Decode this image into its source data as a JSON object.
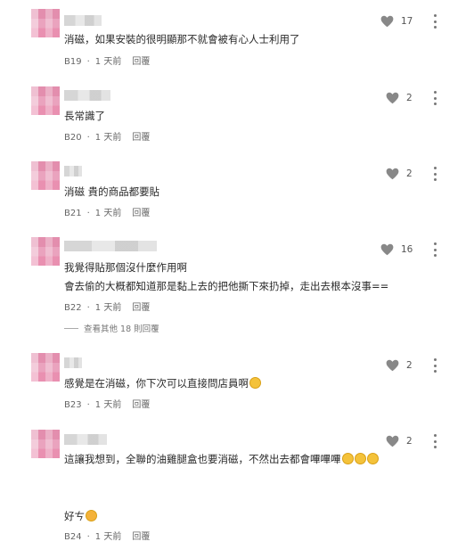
{
  "comments": [
    {
      "text": "消磁，如果安裝的很明顯那不就會被有心人士利用了",
      "floor": "B19",
      "time": "1 天前",
      "reply": "回覆",
      "likes": "17"
    },
    {
      "text": "長常識了",
      "floor": "B20",
      "time": "1 天前",
      "reply": "回覆",
      "likes": "2"
    },
    {
      "text": "消磁 貴的商品都要貼",
      "floor": "B21",
      "time": "1 天前",
      "reply": "回覆",
      "likes": "2"
    },
    {
      "line1": "我覺得貼那個沒什麼作用啊",
      "line2": "會去偷的大概都知道那是黏上去的把他撕下來扔掉，走出去根本沒事==",
      "floor": "B22",
      "time": "1 天前",
      "reply": "回覆",
      "likes": "16",
      "more_replies": "查看其他 18 則回覆"
    },
    {
      "text": "感覺是在消磁，你下次可以直接問店員啊",
      "floor": "B23",
      "time": "1 天前",
      "reply": "回覆",
      "likes": "2"
    },
    {
      "line1": "這讓我想到，全聯的油雞腿盒也要消磁，不然出去都會嗶嗶嗶",
      "line2": "好ㄘ",
      "floor": "B24",
      "time": "1 天前",
      "reply": "回覆",
      "likes": "2"
    }
  ],
  "separator": "·",
  "icons": {
    "like": "heart-icon",
    "more": "more-vertical-icon"
  },
  "colors": {
    "avatar": "#e89ab8",
    "icon": "#888888"
  }
}
